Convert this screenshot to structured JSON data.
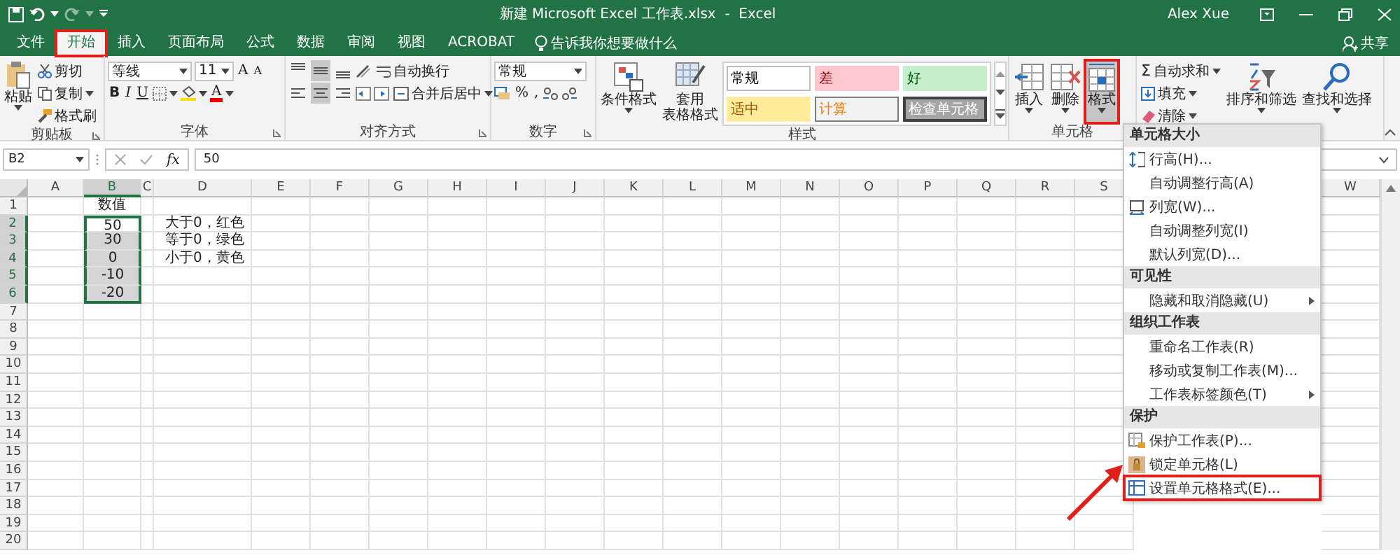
{
  "title_bar": {
    "title": "新建 Microsoft Excel 工作表.xlsx  -  Excel",
    "user": "Alex Xue"
  },
  "tabs": [
    {
      "label": "文件",
      "selected": false,
      "annotated": false
    },
    {
      "label": "开始",
      "selected": true,
      "annotated": true
    },
    {
      "label": "插入",
      "selected": false,
      "annotated": false
    },
    {
      "label": "页面布局",
      "selected": false,
      "annotated": false
    },
    {
      "label": "公式",
      "selected": false,
      "annotated": false
    },
    {
      "label": "数据",
      "selected": false,
      "annotated": false
    },
    {
      "label": "审阅",
      "selected": false,
      "annotated": false
    },
    {
      "label": "视图",
      "selected": false,
      "annotated": false
    },
    {
      "label": "ACROBAT",
      "selected": false,
      "annotated": false
    }
  ],
  "tell_me": "告诉我你想要做什么",
  "share": "共享",
  "clipboard": {
    "paste": "粘贴",
    "cut": "剪切",
    "copy": "复制",
    "format_painter": "格式刷",
    "label": "剪贴板"
  },
  "font": {
    "name": "等线",
    "size": "11",
    "grow": "A",
    "shrink": "A",
    "font_color": "A",
    "label": "字体",
    "styles": [
      {
        "label": "B",
        "kind": "bold"
      },
      {
        "label": "I",
        "kind": "italic"
      },
      {
        "label": "U",
        "kind": "underline"
      }
    ]
  },
  "alignment": {
    "wrap": "自动换行",
    "merge": "合并后居中",
    "label": "对齐方式",
    "vertical": [
      {
        "kind": "top",
        "selected": false
      },
      {
        "kind": "middle",
        "selected": true
      },
      {
        "kind": "bottom",
        "selected": false
      }
    ],
    "horizontal": [
      {
        "kind": "left",
        "selected": false
      },
      {
        "kind": "center",
        "selected": true
      },
      {
        "kind": "right",
        "selected": false
      }
    ]
  },
  "number": {
    "format": "常规",
    "percent": "%",
    "comma": ",",
    "label": "数字"
  },
  "styles": {
    "conditional": "条件格式",
    "table": [
      "套用",
      "表格格式"
    ],
    "label": "样式",
    "cell_styles": [
      {
        "label": "常规",
        "kind": "normal"
      },
      {
        "label": "差",
        "kind": "bad"
      },
      {
        "label": "好",
        "kind": "good"
      },
      {
        "label": "适中",
        "kind": "neutral"
      },
      {
        "label": "计算",
        "kind": "calculation"
      },
      {
        "label": "检查单元格",
        "kind": "check"
      }
    ]
  },
  "cells": {
    "label": "单元格",
    "buttons": [
      {
        "label": "插入",
        "kind": "insert",
        "expanded": false,
        "annotated": false
      },
      {
        "label": "删除",
        "kind": "delete",
        "expanded": false,
        "annotated": false
      },
      {
        "label": "格式",
        "kind": "format",
        "expanded": true,
        "annotated": true
      }
    ]
  },
  "editing": {
    "autosum_icon": "Σ",
    "autosum": "自动求和",
    "fill": "填充",
    "clear": "清除",
    "sort": "排序和筛选",
    "find": "查找和选择"
  },
  "formula_bar": {
    "name_box": "B2",
    "fx": "fx",
    "value": "50"
  },
  "sheet": {
    "columns": [
      {
        "label": "A",
        "selected": false
      },
      {
        "label": "B",
        "selected": true
      },
      {
        "label": "C",
        "selected": false
      },
      {
        "label": "D",
        "selected": false
      },
      {
        "label": "E",
        "selected": false
      },
      {
        "label": "F",
        "selected": false
      },
      {
        "label": "G",
        "selected": false
      },
      {
        "label": "H",
        "selected": false
      },
      {
        "label": "I",
        "selected": false
      },
      {
        "label": "J",
        "selected": false
      },
      {
        "label": "K",
        "selected": false
      },
      {
        "label": "L",
        "selected": false
      },
      {
        "label": "M",
        "selected": false
      },
      {
        "label": "N",
        "selected": false
      },
      {
        "label": "O",
        "selected": false
      },
      {
        "label": "P",
        "selected": false
      },
      {
        "label": "Q",
        "selected": false
      },
      {
        "label": "R",
        "selected": false
      },
      {
        "label": "S",
        "selected": false
      },
      {
        "label": "W",
        "selected": false
      }
    ],
    "rows": [
      {
        "label": "1",
        "selected": false,
        "cells": [
          null,
          {
            "text": "数值",
            "kind": "centered",
            "selected": false,
            "active": false
          }
        ]
      },
      {
        "label": "2",
        "selected": true,
        "cells": [
          null,
          {
            "text": "50",
            "kind": "centered",
            "selected": true,
            "active": true
          },
          null,
          {
            "text": "大于0，红色",
            "kind": "text",
            "selected": false,
            "active": false
          }
        ]
      },
      {
        "label": "3",
        "selected": true,
        "cells": [
          null,
          {
            "text": "30",
            "kind": "centered",
            "selected": true,
            "active": false
          },
          null,
          {
            "text": "等于0，绿色",
            "kind": "text",
            "selected": false,
            "active": false
          }
        ]
      },
      {
        "label": "4",
        "selected": true,
        "cells": [
          null,
          {
            "text": "0",
            "kind": "centered",
            "selected": true,
            "active": false
          },
          null,
          {
            "text": "小于0，黄色",
            "kind": "text",
            "selected": false,
            "active": false
          }
        ]
      },
      {
        "label": "5",
        "selected": true,
        "cells": [
          null,
          {
            "text": "-10",
            "kind": "centered",
            "selected": true,
            "active": false
          }
        ]
      },
      {
        "label": "6",
        "selected": true,
        "cells": [
          null,
          {
            "text": "-20",
            "kind": "centered",
            "selected": true,
            "active": false
          }
        ]
      },
      {
        "label": "7",
        "selected": false
      },
      {
        "label": "8",
        "selected": false
      },
      {
        "label": "9",
        "selected": false
      },
      {
        "label": "10",
        "selected": false
      },
      {
        "label": "11",
        "selected": false
      },
      {
        "label": "12",
        "selected": false
      },
      {
        "label": "13",
        "selected": false
      },
      {
        "label": "14",
        "selected": false
      },
      {
        "label": "15",
        "selected": false
      },
      {
        "label": "16",
        "selected": false
      },
      {
        "label": "17",
        "selected": false
      },
      {
        "label": "18",
        "selected": false
      },
      {
        "label": "19",
        "selected": false
      },
      {
        "label": "20",
        "selected": false
      }
    ]
  },
  "menu": {
    "sections": [
      {
        "heading": "单元格大小",
        "items": [
          {
            "label": "行高(H)...",
            "submenu": false,
            "annotated": false
          },
          {
            "label": "自动调整行高(A)",
            "submenu": false,
            "annotated": false
          },
          {
            "label": "列宽(W)...",
            "submenu": false,
            "annotated": false
          },
          {
            "label": "自动调整列宽(I)",
            "submenu": false,
            "annotated": false
          },
          {
            "label": "默认列宽(D)...",
            "submenu": false,
            "annotated": false
          }
        ]
      },
      {
        "heading": "可见性",
        "items": [
          {
            "label": "隐藏和取消隐藏(U)",
            "submenu": true,
            "annotated": false
          }
        ]
      },
      {
        "heading": "组织工作表",
        "items": [
          {
            "label": "重命名工作表(R)",
            "submenu": false,
            "annotated": false
          },
          {
            "label": "移动或复制工作表(M)...",
            "submenu": false,
            "annotated": false
          },
          {
            "label": "工作表标签颜色(T)",
            "submenu": true,
            "annotated": false
          }
        ]
      },
      {
        "heading": "保护",
        "items": [
          {
            "label": "保护工作表(P)...",
            "submenu": false,
            "annotated": false
          },
          {
            "label": "锁定单元格(L)",
            "submenu": false,
            "annotated": false
          },
          {
            "label": "设置单元格格式(E)...",
            "submenu": false,
            "annotated": true
          }
        ]
      }
    ]
  }
}
